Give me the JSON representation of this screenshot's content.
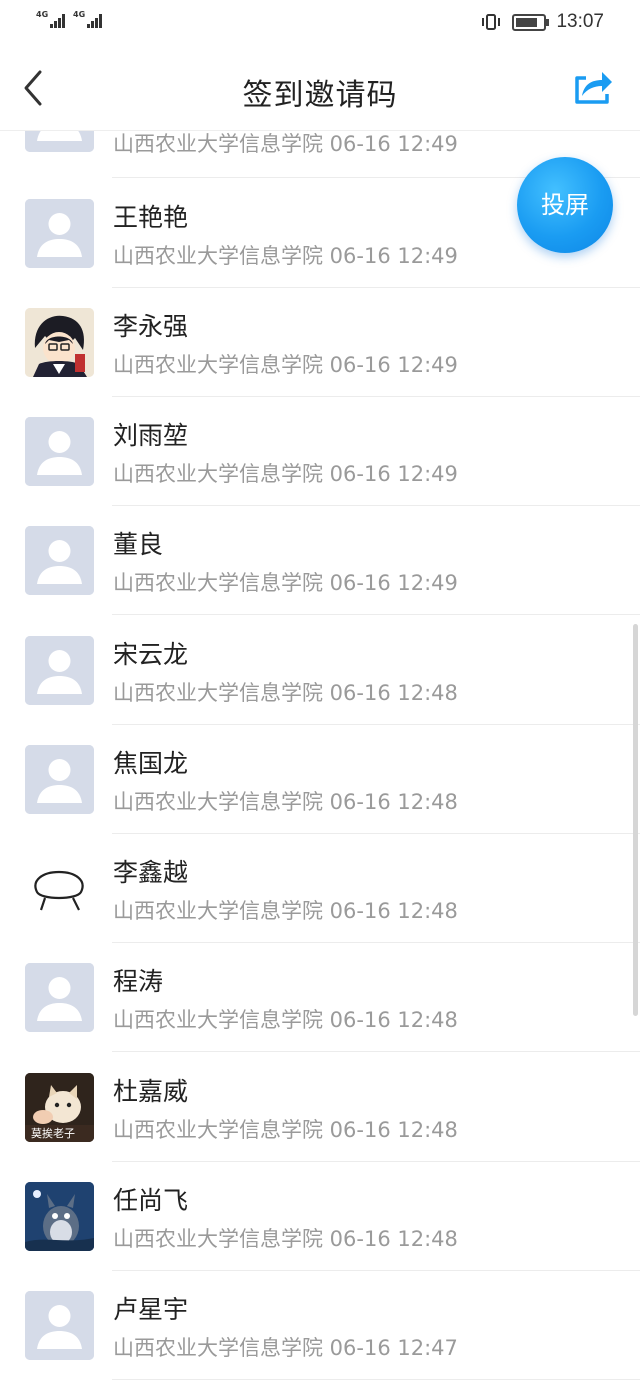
{
  "status_bar": {
    "network_1": "4G",
    "network_2": "4G",
    "time": "13:07"
  },
  "header": {
    "title": "签到邀请码"
  },
  "floating_button": {
    "label": "投屏"
  },
  "entries": [
    {
      "name": "",
      "info": "山西农业大学信息学院 06-16 12:49",
      "avatar": "default"
    },
    {
      "name": "王艳艳",
      "info": "山西农业大学信息学院 06-16 12:49",
      "avatar": "default"
    },
    {
      "name": "李永强",
      "info": "山西农业大学信息学院 06-16 12:49",
      "avatar": "anime"
    },
    {
      "name": "刘雨堃",
      "info": "山西农业大学信息学院 06-16 12:49",
      "avatar": "default"
    },
    {
      "name": "董良",
      "info": "山西农业大学信息学院 06-16 12:49",
      "avatar": "default"
    },
    {
      "name": "宋云龙",
      "info": "山西农业大学信息学院 06-16 12:48",
      "avatar": "default"
    },
    {
      "name": "焦国龙",
      "info": "山西农业大学信息学院 06-16 12:48",
      "avatar": "default"
    },
    {
      "name": "李鑫越",
      "info": "山西农业大学信息学院 06-16 12:48",
      "avatar": "doodle"
    },
    {
      "name": "程涛",
      "info": "山西农业大学信息学院 06-16 12:48",
      "avatar": "default"
    },
    {
      "name": "杜嘉威",
      "info": "山西农业大学信息学院 06-16 12:48",
      "avatar": "cat",
      "avatar_caption": "莫挨老子"
    },
    {
      "name": "任尚飞",
      "info": "山西农业大学信息学院 06-16 12:48",
      "avatar": "totoro"
    },
    {
      "name": "卢星宇",
      "info": "山西农业大学信息学院 06-16 12:47",
      "avatar": "default"
    }
  ],
  "colors": {
    "accent": "#1a9cf2",
    "default_avatar_bg": "#d5dbe8",
    "meta_text": "#9a9a9a"
  }
}
